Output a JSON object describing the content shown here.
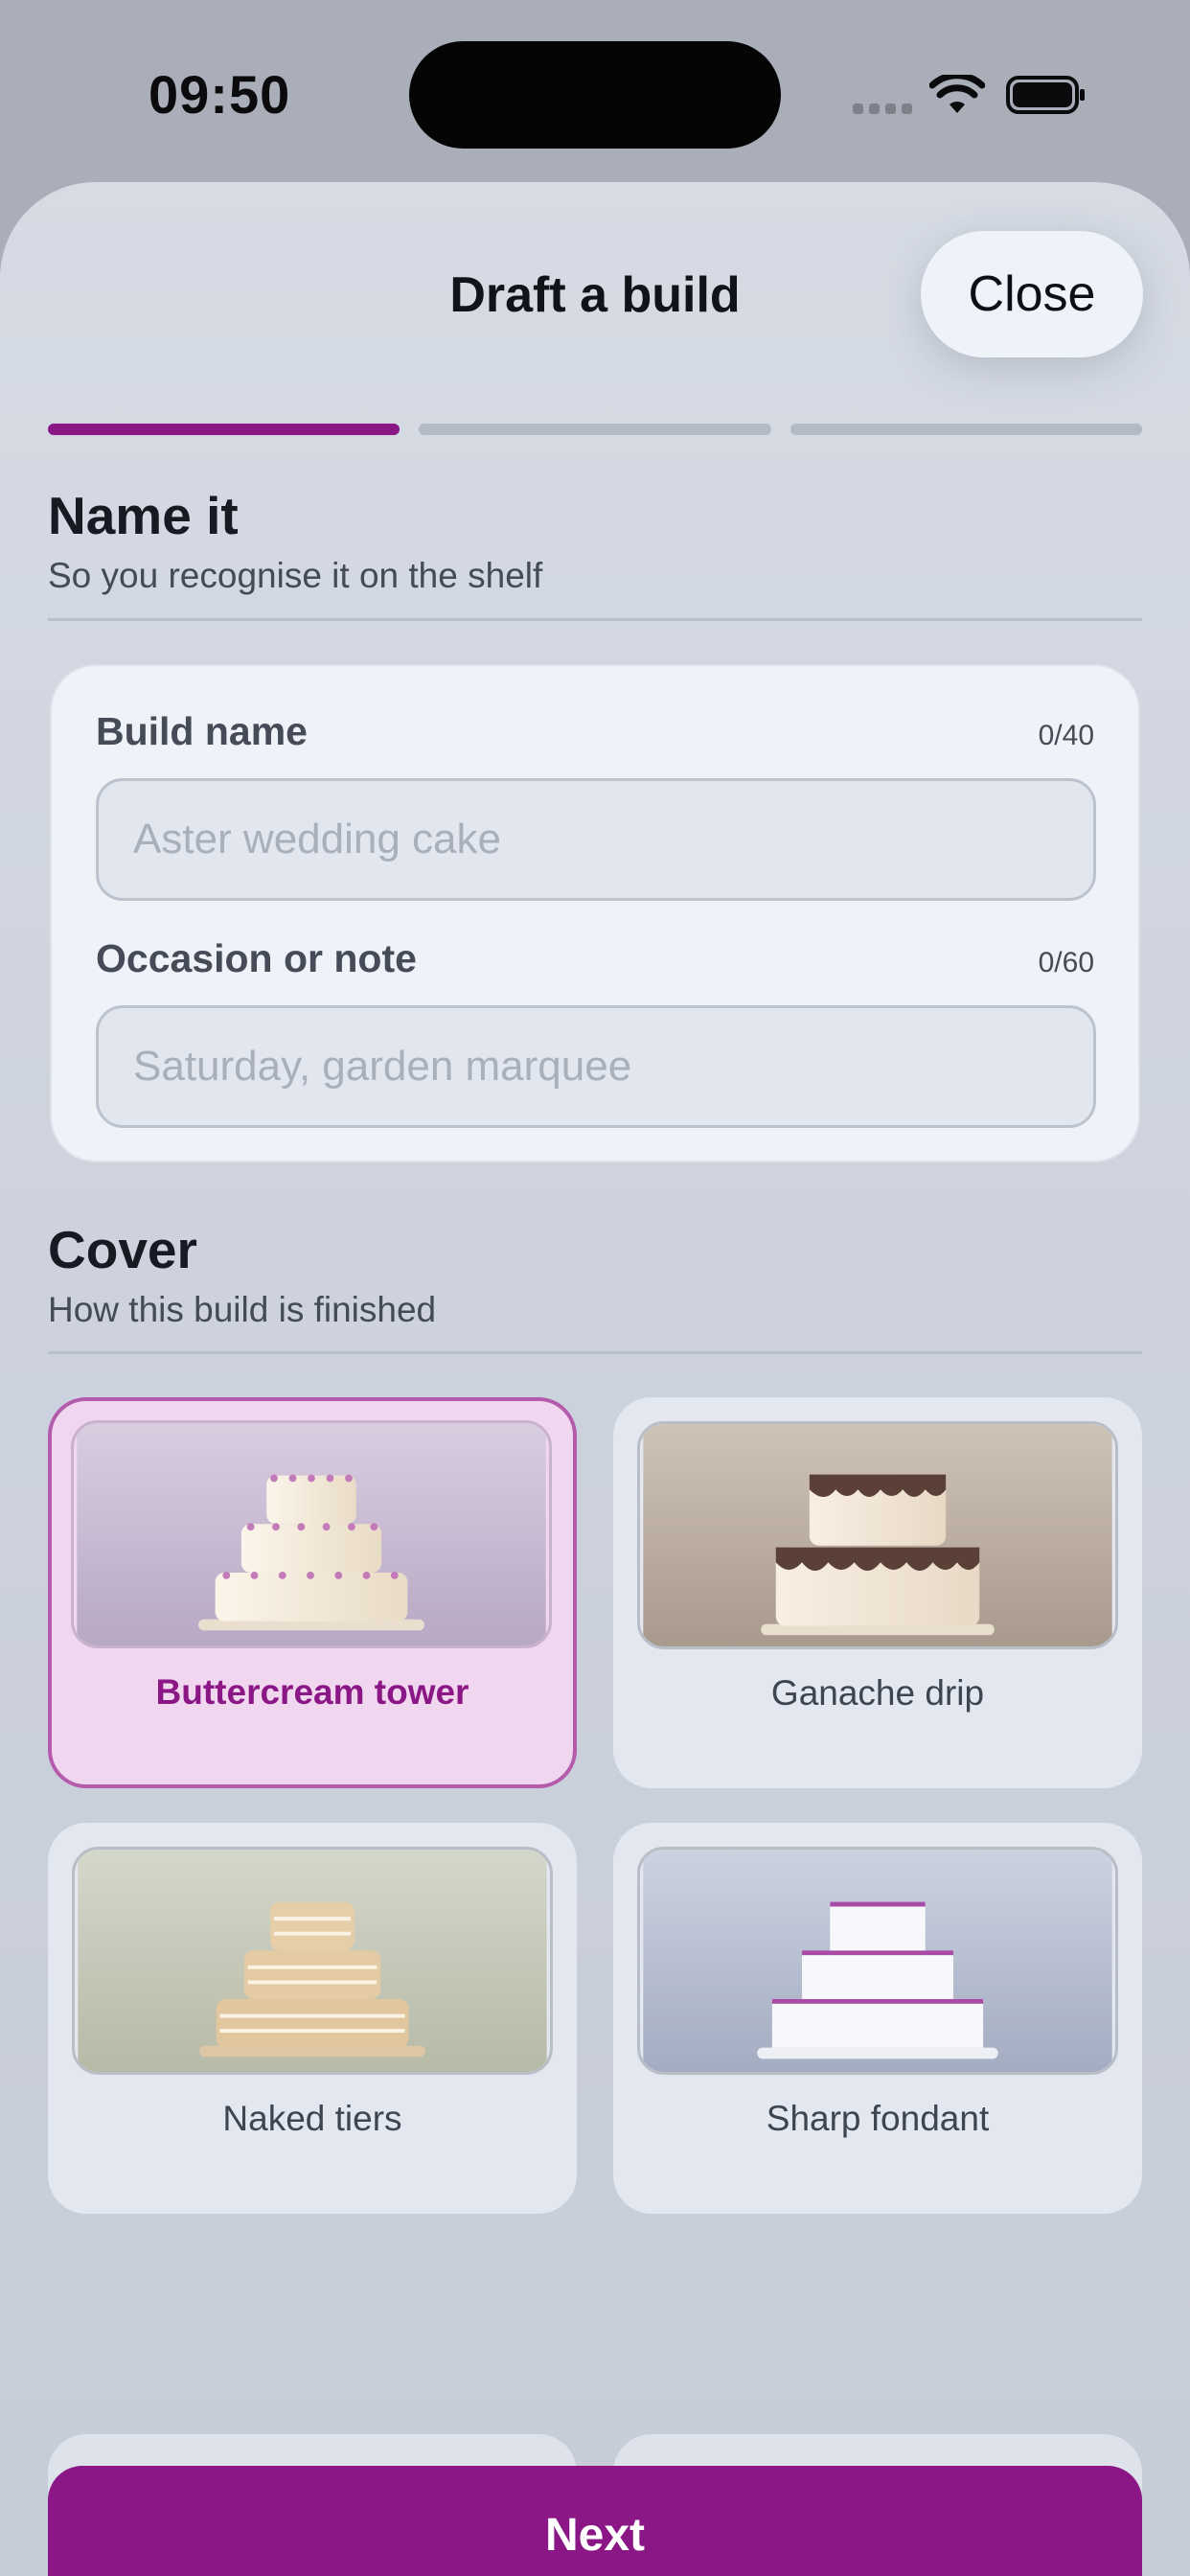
{
  "status_bar": {
    "time": "09:50"
  },
  "sheet": {
    "title": "Draft a build",
    "close_label": "Close",
    "progress": {
      "total_steps": 3,
      "current_step": 1,
      "accent": "#8a1785"
    }
  },
  "name_section": {
    "title": "Name it",
    "subtitle": "So you recognise it on the shelf",
    "fields": [
      {
        "label": "Build name",
        "count": "0/40",
        "value": "",
        "placeholder": "Aster wedding cake"
      },
      {
        "label": "Occasion or note",
        "count": "0/60",
        "value": "",
        "placeholder": "Saturday, garden marquee"
      }
    ]
  },
  "cover_section": {
    "title": "Cover",
    "subtitle": "How this build is finished",
    "options": [
      {
        "label": "Buttercream tower",
        "selected": true,
        "icon": "buttercream-cake-icon"
      },
      {
        "label": "Ganache drip",
        "selected": false,
        "icon": "ganache-cake-icon"
      },
      {
        "label": "Naked tiers",
        "selected": false,
        "icon": "naked-cake-icon"
      },
      {
        "label": "Sharp fondant",
        "selected": false,
        "icon": "fondant-cake-icon"
      }
    ]
  },
  "footer": {
    "next_label": "Next"
  },
  "colors": {
    "accent": "#8a1785",
    "selected_bg": "#f0d6ee",
    "selected_border": "#b45cab"
  }
}
